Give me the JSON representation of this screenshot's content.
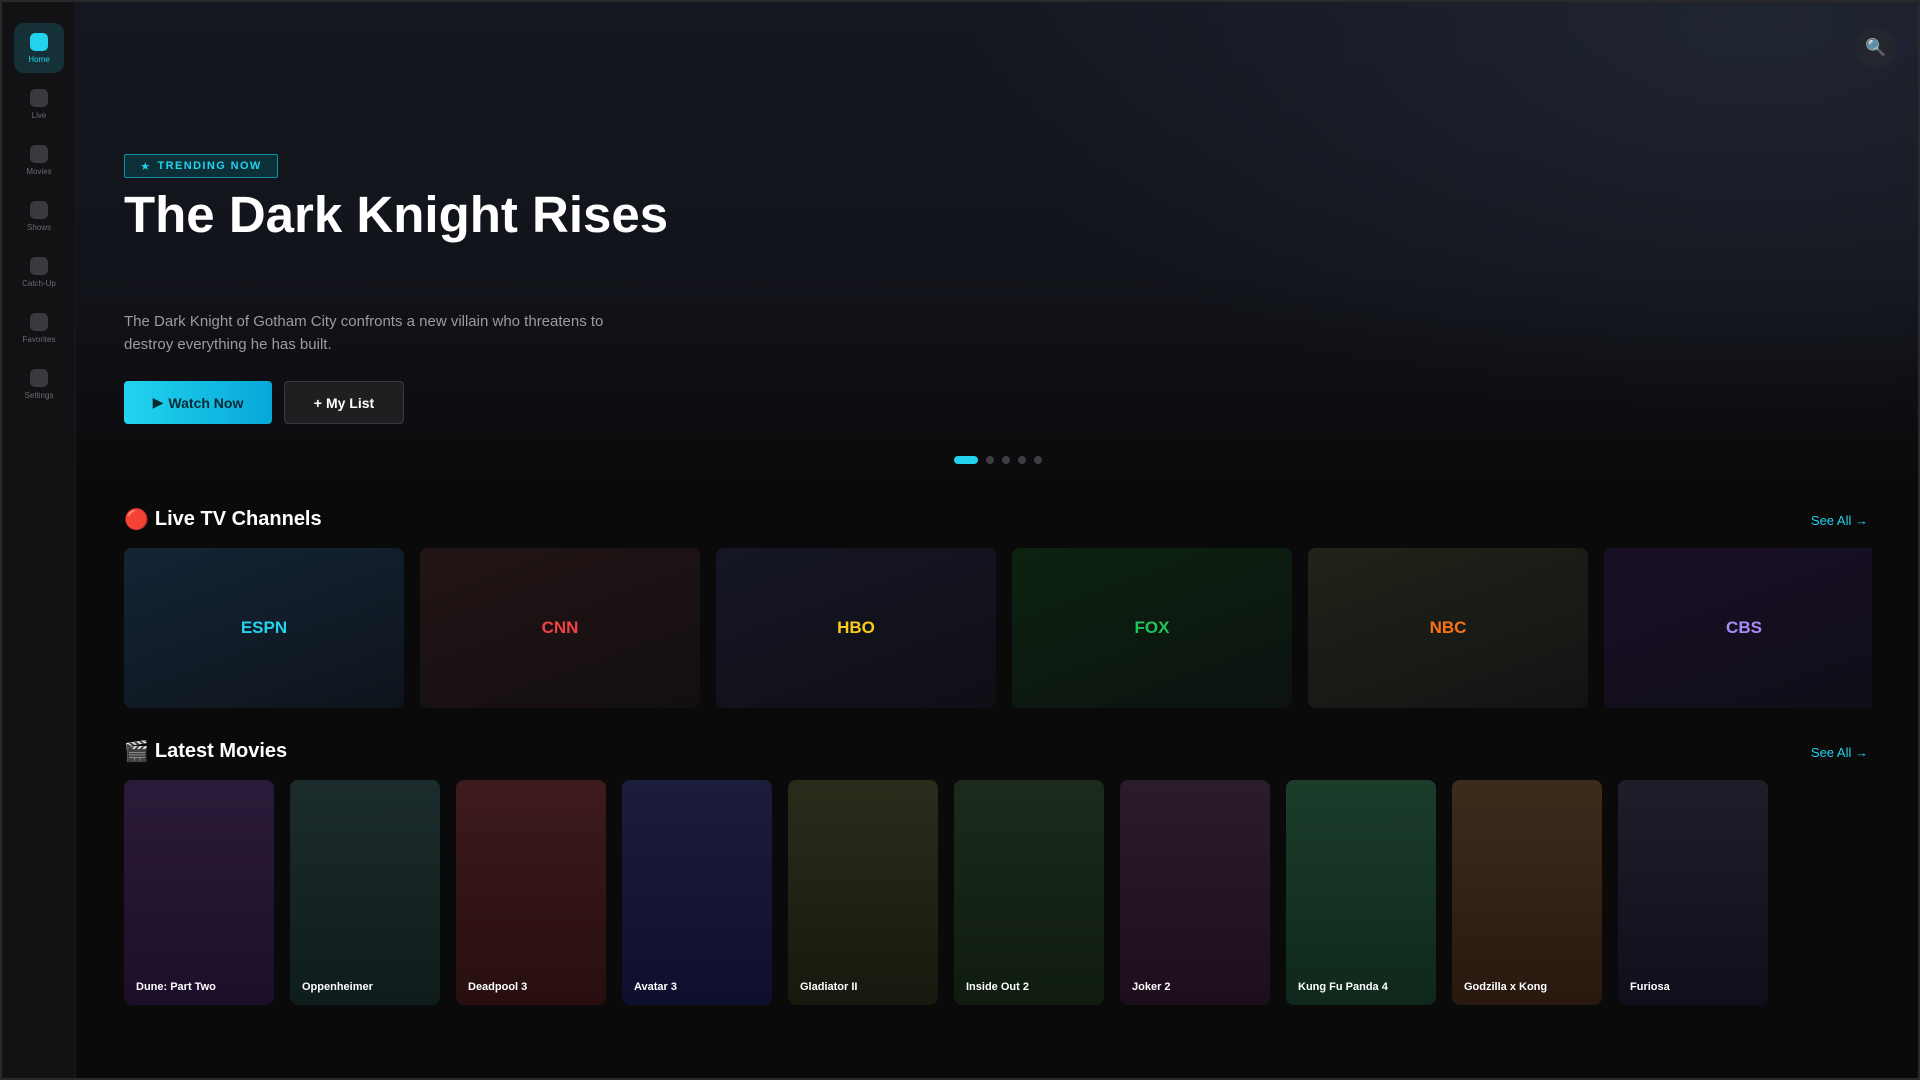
{
  "sidebar": {
    "items": [
      {
        "label": "Home",
        "icon": "home-icon",
        "active": true
      },
      {
        "label": "Live",
        "icon": "live-tv-icon",
        "active": false
      },
      {
        "label": "Movies",
        "icon": "movies-icon",
        "active": false
      },
      {
        "label": "Shows",
        "icon": "shows-icon",
        "active": false
      },
      {
        "label": "Catch-Up",
        "icon": "catch-up-icon",
        "active": false
      },
      {
        "label": "Favorites",
        "icon": "favorites-icon",
        "active": false
      },
      {
        "label": "Settings",
        "icon": "settings-icon",
        "active": false
      }
    ]
  },
  "header": {
    "search_icon": "🔍"
  },
  "hero": {
    "badge": {
      "icon": "★",
      "label": "TRENDING NOW"
    },
    "title": "The Dark Knight Rises",
    "description": "The Dark Knight of Gotham City confronts a new villain who threatens to destroy everything he has built.",
    "watch_button": {
      "icon": "▶",
      "label": "Watch Now"
    },
    "list_button": {
      "icon": "+",
      "label": "My List"
    },
    "carousel": {
      "count": 5,
      "active_index": 0
    }
  },
  "live_channels": {
    "icon": "🔴",
    "title": "Live TV Channels",
    "see_all": "See All →",
    "channels": [
      {
        "name": "ESPN",
        "color": "#22d3ee",
        "bg": "#142536"
      },
      {
        "name": "CNN",
        "color": "#ef4444",
        "bg": "#221414"
      },
      {
        "name": "HBO",
        "color": "#facc15",
        "bg": "#151624"
      },
      {
        "name": "FOX",
        "color": "#22c55e",
        "bg": "#0c220f"
      },
      {
        "name": "NBC",
        "color": "#f97316",
        "bg": "#23231a"
      },
      {
        "name": "CBS",
        "color": "#a78bfa",
        "bg": "#190f27"
      }
    ]
  },
  "latest_movies": {
    "icon": "🎬",
    "title": "Latest Movies",
    "see_all": "See All →",
    "movies": [
      {
        "title": "Dune: Part Two",
        "bg_top": "#2b1b3a",
        "bg_bottom": "#1c0e28"
      },
      {
        "title": "Oppenheimer",
        "bg_top": "#1c2b2b",
        "bg_bottom": "#0f1c1c"
      },
      {
        "title": "Deadpool 3",
        "bg_top": "#3d1a1e",
        "bg_bottom": "#280e0f"
      },
      {
        "title": "Avatar 3",
        "bg_top": "#1c1c3d",
        "bg_bottom": "#0e0e2e"
      },
      {
        "title": "Gladiator II",
        "bg_top": "#2b2b1c",
        "bg_bottom": "#18180e"
      },
      {
        "title": "Inside Out 2",
        "bg_top": "#1c2b1c",
        "bg_bottom": "#0f1c0f"
      },
      {
        "title": "Joker 2",
        "bg_top": "#2b1c2b",
        "bg_bottom": "#1c0e1c"
      },
      {
        "title": "Kung Fu Panda 4",
        "bg_top": "#1c3d2b",
        "bg_bottom": "#0e281c"
      },
      {
        "title": "Godzilla x Kong",
        "bg_top": "#3d2b1c",
        "bg_bottom": "#28180e"
      },
      {
        "title": "Furiosa",
        "bg_top": "#1e1e2b",
        "bg_bottom": "#0f0f1c"
      }
    ]
  }
}
